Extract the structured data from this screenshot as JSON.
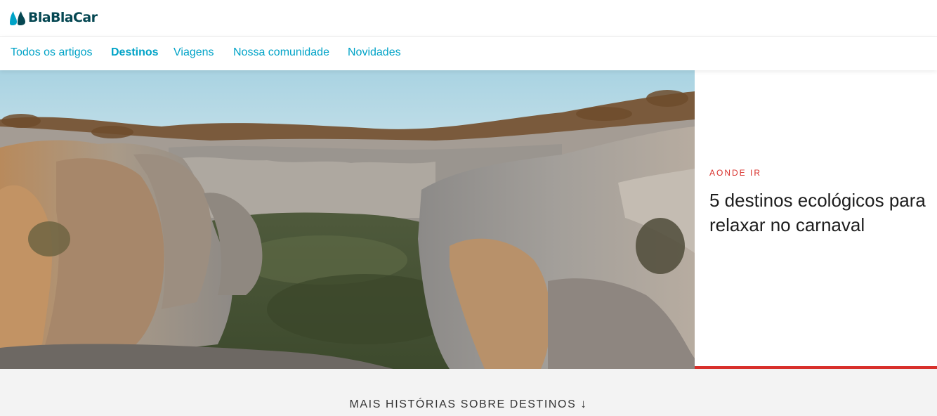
{
  "header": {
    "logo_text": "BlaBlaCar"
  },
  "nav": {
    "items": [
      {
        "label": "Todos os artigos",
        "active": false
      },
      {
        "label": "Destinos",
        "active": true
      },
      {
        "label": "Viagens",
        "active": false
      },
      {
        "label": "Nossa comunidade",
        "active": false
      },
      {
        "label": "Novidades",
        "active": false
      }
    ]
  },
  "featured": {
    "category": "AONDE IR",
    "title": "5 destinos ecológicos para relaxar no carnaval",
    "image_icon": "canyon-landscape-photo"
  },
  "more_stories": {
    "label": "MAIS HISTÓRIAS SOBRE DESTINOS",
    "icon": "arrow-down-icon"
  },
  "colors": {
    "brand": "#054752",
    "link": "#00a3c7",
    "accent": "#d8302b",
    "footer_bg": "#f3f3f3"
  }
}
